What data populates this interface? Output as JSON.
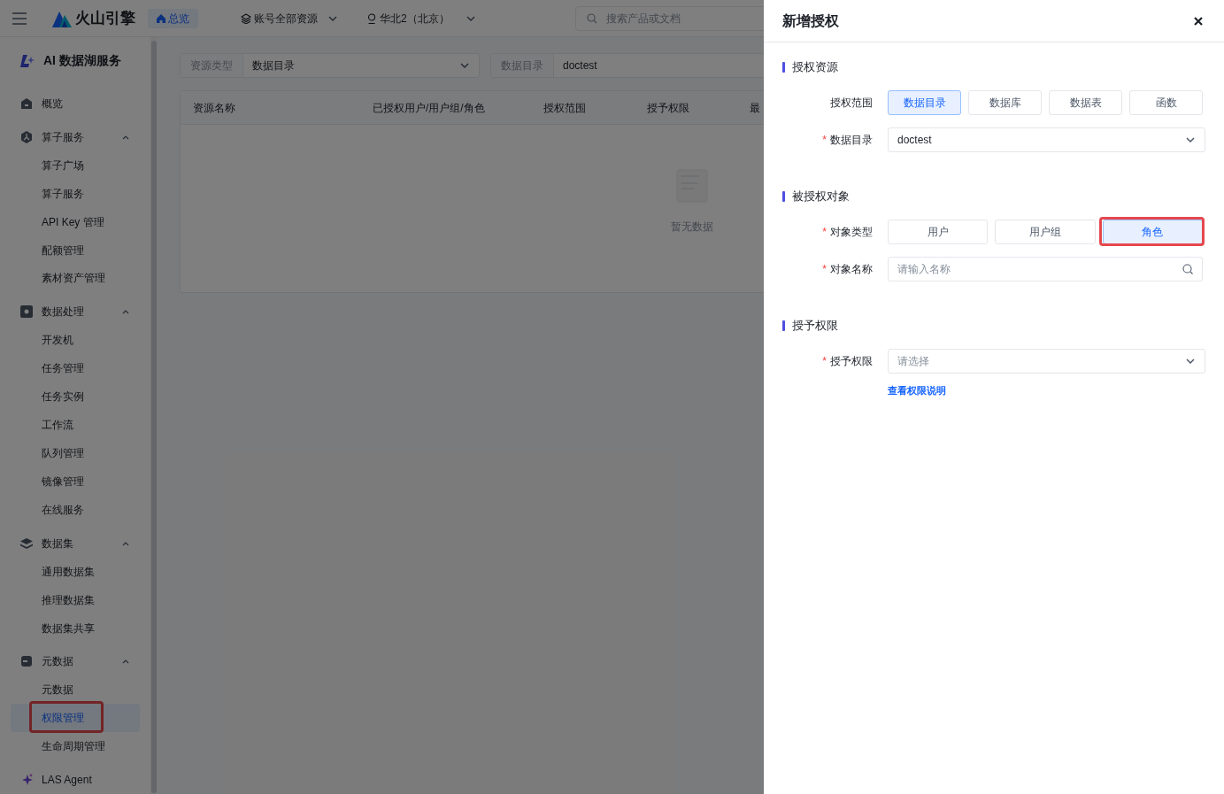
{
  "topbar": {
    "brand": "火山引擎",
    "home_tag": "总览",
    "account": "账号全部资源",
    "region": "华北2（北京）",
    "search": {
      "placeholder": "搜索产品或文档"
    }
  },
  "sidebar": {
    "title": "AI 数据湖服务",
    "items": [
      {
        "label": "概览",
        "kind": "link",
        "selected": false
      },
      {
        "label": "算子服务",
        "kind": "group",
        "expanded": true,
        "children": [
          {
            "label": "算子广场",
            "selected": false,
            "highlighted": false
          },
          {
            "label": "算子服务",
            "selected": false,
            "highlighted": false
          },
          {
            "label": "API Key 管理",
            "selected": false,
            "highlighted": false
          },
          {
            "label": "配额管理",
            "selected": false,
            "highlighted": false
          },
          {
            "label": "素材资产管理",
            "selected": false,
            "highlighted": false
          }
        ]
      },
      {
        "label": "数据处理",
        "kind": "group",
        "expanded": true,
        "children": [
          {
            "label": "开发机",
            "selected": false,
            "highlighted": false
          },
          {
            "label": "任务管理",
            "selected": false,
            "highlighted": false
          },
          {
            "label": "任务实例",
            "selected": false,
            "highlighted": false
          },
          {
            "label": "工作流",
            "selected": false,
            "highlighted": false
          },
          {
            "label": "队列管理",
            "selected": false,
            "highlighted": false
          },
          {
            "label": "镜像管理",
            "selected": false,
            "highlighted": false
          },
          {
            "label": "在线服务",
            "selected": false,
            "highlighted": false
          }
        ]
      },
      {
        "label": "数据集",
        "kind": "group",
        "expanded": true,
        "children": [
          {
            "label": "通用数据集",
            "selected": false,
            "highlighted": false
          },
          {
            "label": "推理数据集",
            "selected": false,
            "highlighted": false
          },
          {
            "label": "数据集共享",
            "selected": false,
            "highlighted": false
          }
        ]
      },
      {
        "label": "元数据",
        "kind": "group",
        "expanded": true,
        "children": [
          {
            "label": "元数据",
            "selected": false,
            "highlighted": false
          },
          {
            "label": "权限管理",
            "selected": true,
            "highlighted": true
          },
          {
            "label": "生命周期管理",
            "selected": false,
            "highlighted": false
          }
        ]
      },
      {
        "label": "LAS Agent",
        "kind": "link",
        "selected": false
      }
    ]
  },
  "filters": [
    {
      "label": "资源类型",
      "value": "数据目录",
      "kind": "select"
    },
    {
      "label": "数据目录",
      "value": "doctest",
      "kind": "text"
    }
  ],
  "table": {
    "columns": [
      "资源名称",
      "已授权用户/用户组/角色",
      "授权范围",
      "授予权限",
      "最"
    ],
    "empty_text": "暂无数据"
  },
  "drawer": {
    "title": "新增授权",
    "sections": [
      {
        "title": "授权资源",
        "fields": [
          {
            "label": "授权范围",
            "kind": "segmented",
            "options": [
              {
                "label": "数据目录",
                "selected": true,
                "highlighted": false
              },
              {
                "label": "数据库",
                "selected": false,
                "highlighted": false
              },
              {
                "label": "数据表",
                "selected": false,
                "highlighted": false
              },
              {
                "label": "函数",
                "selected": false,
                "highlighted": false
              }
            ]
          },
          {
            "label": "数据目录",
            "required_mark": "*",
            "kind": "select",
            "value": "doctest"
          }
        ]
      },
      {
        "title": "被授权对象",
        "fields": [
          {
            "label": "对象类型",
            "required_mark": "*",
            "kind": "segmented",
            "options": [
              {
                "label": "用户",
                "selected": false,
                "highlighted": false
              },
              {
                "label": "用户组",
                "selected": false,
                "highlighted": false
              },
              {
                "label": "角色",
                "selected": true,
                "highlighted": true
              }
            ]
          },
          {
            "label": "对象名称",
            "required_mark": "*",
            "kind": "search",
            "placeholder": "请输入名称"
          }
        ]
      },
      {
        "title": "授予权限",
        "fields": [
          {
            "label": "授予权限",
            "required_mark": "*",
            "kind": "select",
            "placeholder": "请选择",
            "link": "查看权限说明"
          }
        ]
      }
    ]
  }
}
